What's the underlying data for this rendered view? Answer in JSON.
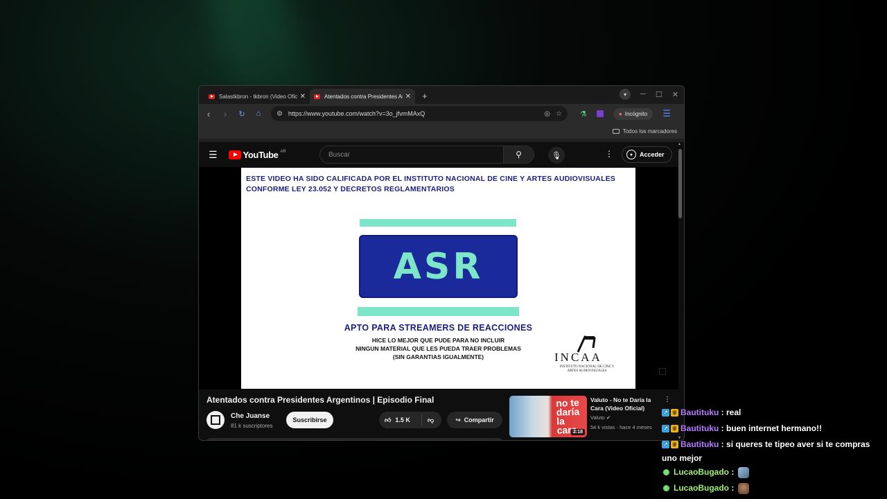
{
  "browser": {
    "tabs": [
      {
        "title": "Salastkbron - tkbron (Video Oficial)",
        "active": false
      },
      {
        "title": "Atentados contra Presidentes Argentinos",
        "active": true
      }
    ],
    "url": "https://www.youtube.com/watch?v=3o_jfvmMAxQ",
    "incognito_label": "Incógnito",
    "bookmarks_label": "Todos los marcadores"
  },
  "youtube": {
    "logo_text": "YouTube",
    "country": "AR",
    "search_placeholder": "Buscar",
    "signin_label": "Acceder"
  },
  "video_frame": {
    "notice_line1": "ESTE VIDEO HA SIDO CALIFICADA POR EL INSTITUTO NACIONAL DE CINE Y ARTES AUDIOVISUALES",
    "notice_line2": "CONFORME LEY 23.052 Y DECRETOS REGLAMENTARIOS",
    "rating": "ASR",
    "apto": "APTO PARA STREAMERS DE REACCIONES",
    "hice_line1": "HICE LO MEJOR QUE PUDE PARA NO INCLUIR",
    "hice_line2": "NINGUN MATERIAL QUE LES PUEDA TRAER PROBLEMAS",
    "hice_line3": "(SIN GARANTIAS IGUALMENTE)",
    "logo_word": "INCAA",
    "logo_sub": "INSTITUTO NACIONAL DE CINE Y ARTES AUDIOVISUALES"
  },
  "video": {
    "title": "Atentados contra Presidentes Argentinos | Episodio Final",
    "channel": "Che Juanse",
    "subscribers": "81 k suscriptores",
    "subscribe_label": "Suscribirse",
    "likes": "1.5 K",
    "share_label": "Compartir"
  },
  "recommended": {
    "title": "Valuto - No te Daría la Cara (Video Oficial)",
    "channel": "Valuto",
    "meta": "54 k vistas · hace 4 meses",
    "duration": "2:18",
    "thumb_text": "no te daría la cara"
  },
  "chat": [
    {
      "user": "Bautituku",
      "message": "real",
      "color": "#b67cff",
      "badge": "sub"
    },
    {
      "user": "Bautituku",
      "message": "buen internet hermano!!",
      "color": "#b67cff",
      "badge": "sub"
    },
    {
      "user": "Bautituku",
      "message": "si queres te tipeo aver si te compras",
      "message_cont": "uno mejor",
      "color": "#b67cff",
      "badge": "sub"
    },
    {
      "user": "LucaoBugado",
      "message": "",
      "color": "#9ef07a",
      "badge": "green",
      "emote": "emote-1"
    },
    {
      "user": "LucaoBugado",
      "message": "",
      "color": "#9ef07a",
      "badge": "green",
      "emote": "emote-2"
    }
  ]
}
